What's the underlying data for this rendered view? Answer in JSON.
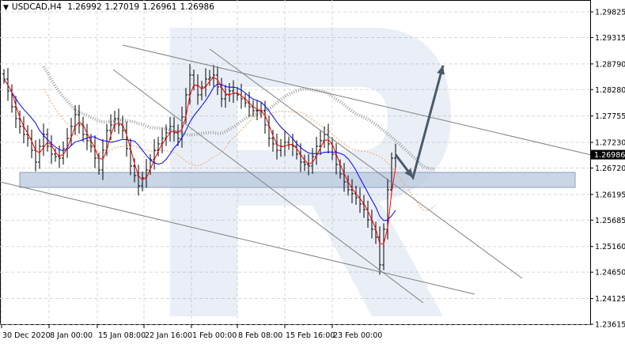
{
  "header": {
    "symbol": "USDCAD,H4",
    "open": "1.26992",
    "high": "1.27019",
    "low": "1.26961",
    "close": "1.26986",
    "menu_icon": "triangle-down-icon"
  },
  "chart_data": {
    "type": "candlestick",
    "title": "USDCAD,H4",
    "ylim": [
      1.23615,
      1.29825
    ],
    "y_ticks": [
      "1.29825",
      "1.29315",
      "1.28790",
      "1.28280",
      "1.27755",
      "1.27230",
      "1.26720",
      "1.26195",
      "1.25685",
      "1.25160",
      "1.24650",
      "1.24125",
      "1.23615"
    ],
    "current_price_label": "1.26986",
    "x_ticks": [
      {
        "label": "30 Dec 2020",
        "bar": -0.6
      },
      {
        "label": "8 Jan 00:00",
        "bar": 11.4
      },
      {
        "label": "15 Jan 08:00",
        "bar": 23.6
      },
      {
        "label": "22 Jan 16:00",
        "bar": 35.4
      },
      {
        "label": "1 Feb 00:00",
        "bar": 47.4
      },
      {
        "label": "8 Feb 08:00",
        "bar": 59.0
      },
      {
        "label": "15 Feb 16:00",
        "bar": 71.0
      },
      {
        "label": "23 Feb 00:00",
        "bar": 83.0
      }
    ],
    "xlim_bars": [
      -1,
      148
    ],
    "closes": [
      1.28489,
      1.28253,
      1.27939,
      1.27703,
      1.27546,
      1.27389,
      1.2731,
      1.27074,
      1.26838,
      1.27153,
      1.27389,
      1.27153,
      1.26996,
      1.26948,
      1.26917,
      1.27106,
      1.2731,
      1.27546,
      1.27782,
      1.27577,
      1.27389,
      1.27263,
      1.27153,
      1.26917,
      1.26681,
      1.27074,
      1.27467,
      1.27577,
      1.27703,
      1.27577,
      1.27467,
      1.27106,
      1.2676,
      1.26571,
      1.26367,
      1.26524,
      1.26681,
      1.26886,
      1.27074,
      1.272,
      1.2731,
      1.2742,
      1.27546,
      1.2742,
      1.2731,
      1.27734,
      1.28175,
      1.28568,
      1.28363,
      1.28175,
      1.28332,
      1.28489,
      1.2852,
      1.28568,
      1.28332,
      1.28096,
      1.28175,
      1.28253,
      1.28206,
      1.28175,
      1.28096,
      1.28017,
      1.27939,
      1.2786,
      1.2786,
      1.2786,
      1.27577,
      1.2731,
      1.272,
      1.27074,
      1.27153,
      1.27231,
      1.27184,
      1.27153,
      1.26996,
      1.26838,
      1.26791,
      1.2676,
      1.26948,
      1.27153,
      1.27263,
      1.27389,
      1.272,
      1.26996,
      1.26791,
      1.26603,
      1.26445,
      1.26288,
      1.2621,
      1.26131,
      1.26005,
      1.25895,
      1.25691,
      1.25502,
      1.25345,
      1.24795,
      1.25502,
      1.26288,
      1.26917,
      1.26986
    ],
    "indicators": {
      "fast_ma_color": "#ff0000",
      "slow_ma_color": "#0000ff",
      "cloud_color": "#a0a0a0",
      "cloud_edge_color": "#f4a460"
    },
    "support_zone": {
      "from_bar": 4,
      "to_bar": 144.4,
      "price_top": 1.26633,
      "price_bottom": 1.26335,
      "color": "#b8c8dc"
    },
    "trend_lines": [
      {
        "from": [
          30,
          1.29165
        ],
        "to": [
          148.2,
          1.26986
        ]
      },
      {
        "from": [
          27.6,
          1.28677
        ],
        "to": [
          106,
          1.2404
        ]
      },
      {
        "from": [
          52,
          1.29086
        ],
        "to": [
          131,
          1.24527
        ]
      },
      {
        "from": [
          -1,
          1.26445
        ],
        "to": [
          119,
          1.24212
        ]
      }
    ],
    "forecast_arrow": {
      "points": [
        [
          99,
          1.26986
        ],
        [
          103.4,
          1.2653
        ],
        [
          111,
          1.2876
        ]
      ],
      "color": "#4a5a6a"
    }
  }
}
